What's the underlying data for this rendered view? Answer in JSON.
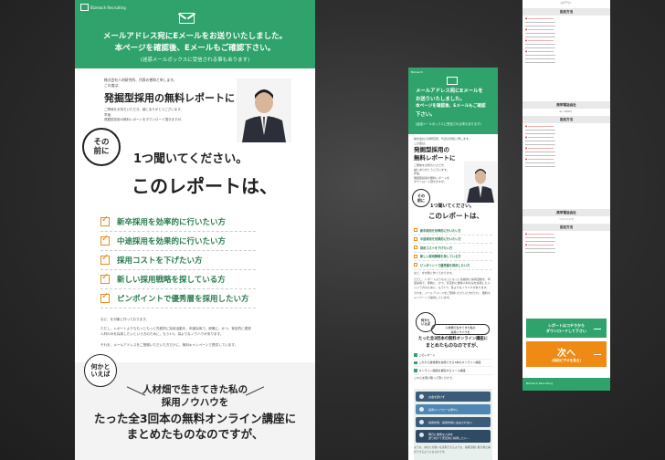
{
  "pc": {
    "logo": "Bizreach Recruiting",
    "headline1": "メールアドレス宛にEメールをお送りいたしました。",
    "headline2": "本ページを確認後、Eメールもご確認下さい。",
    "headline_note": "(迷惑メールボックスに受信される事もあります)",
    "intro1": "株式会社人材研究所、代表の曽和と申します。",
    "intro2": "この度は、",
    "title": "発掘型採用の無料レポートに",
    "desc1": "ご興味をお持ちいただき、誠にありがとうございます。",
    "desc2": "早速、",
    "desc3": "発掘型採用の無料レポートをダウンロード頂きますが、",
    "badge_sono": "その\n前に",
    "listen": "1つ聞いてください。",
    "report": "このレポートは、",
    "checks": [
      "新卒採用を効率的に行いたい方",
      "中途採用を効果的に行いたい方",
      "採用コストを下げたい方",
      "新しい採用戦略を探している方",
      "ピンポイントで優秀層を採用したい方"
    ],
    "para1": "など、を対象に作っております。",
    "para2": "ただし、レポートよりももっともっと先鋭的に採用活動を、年度採用で、即戦に、かつ、背定的に優秀人材のみを採用したいという方のために、もう1つ、耳よりなノウハウがあります。",
    "para3": "それを、メールアドレスをご登録いただいた方だけに、無料キャンペーンで提供しています。",
    "badge_nanika": "何かと\nいえば",
    "know1": "人材畑で生きてきた私の",
    "know2": "採用ノウハウを",
    "online1": "たった全3回本の無料オンライン講座に",
    "online2": "まとめたものなのですが、"
  },
  "sp": {
    "logo": "Bizreach",
    "headline1": "メールアドレス宛にEメールを",
    "headline2": "お送りいたしました。",
    "headline3": "本ページを確認後、Eメールもご確認",
    "headline4": "下さい。",
    "headline_note": "(迷惑メールボックスに受信される事もあります)",
    "intro1": "株式会社人材研究所、代表の曽和と申します。",
    "intro2": "この度は、",
    "title1": "発掘型採用の",
    "title2": "無料レポートに",
    "desc1": "ご興味をお持ちいただき、",
    "desc2": "誠にありがとうございます。",
    "desc3": "早速、",
    "desc4": "発掘型採用の無料レポートを",
    "desc5": "ダウンロード頂きますが、",
    "badge_sono": "その\n前に",
    "listen": "1つ聞いてください。",
    "report": "このレポートは、",
    "checks": [
      "新卒採用を効率的に行いたい方",
      "中途採用を効果的に行いたい方",
      "採用コストを下げたい方",
      "新しい採用戦略を探している方",
      "ピンポイントで優秀層を採用したい方"
    ],
    "para1": "など、を対象に作っております。",
    "para2": "ただし、レポートよりももっともっと先鋭的に採用活動を、年度採用で、即戦に、かつ、背定的に優秀人材のみを採用したいという方のために、もう1つ、耳よりなノウハウがあります。",
    "para3": "それを、メールアドレスをご登録いただいた方だけに、無料キャンペーンで提供しています。",
    "badge_nanika": "何かと\nいえば",
    "quote": "人材畑で生きてきた私の\n採用ノウハウを",
    "online1": "たった全3回本の無料オンライン講座に",
    "online2": "まとめたものなのですが、",
    "list": [
      "このレポート",
      "これから優秀層を採用できる3本のオンライン講座",
      "オンライン講座を補完するメール講座"
    ],
    "list_note": "これらを受け取って頂くだけで、",
    "steps": [
      "お金を掛けず",
      "採用マンパワーも増やし",
      "採用市場、採用市場に左右されない",
      "明日に優秀な人材を\n送り続けて安定的に採用したい…"
    ],
    "footer_note": "ような、あなたの思いを実現できるような、採用活動に取り組む事ができるようになるのです。"
  },
  "rp": {
    "top": "ログアウト",
    "settings1": "設定方法",
    "carrier1": "携帯電話会社",
    "carrier1_name": "au（KDDI）",
    "settings2": "設定方法",
    "carrier2": "携帯電話会社",
    "carrier2_name": "ソフトバンク",
    "settings3": "設定方法",
    "green_btn": "レポートはコチラから\nダウンロードして下さい",
    "orange_big": "次へ",
    "orange_small": "(特別ビデオを見る)",
    "footer": "Bizreach Recruiting"
  },
  "colors": {
    "green": "#2fa36b",
    "orange": "#ef8a14",
    "check_text": "#2a7c4f"
  }
}
